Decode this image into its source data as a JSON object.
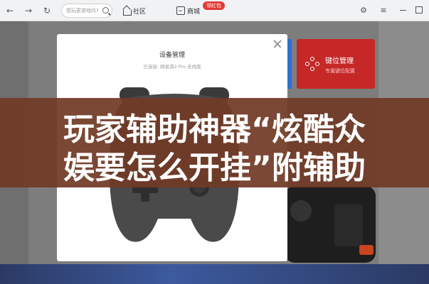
{
  "toolbar": {
    "search_placeholder": "想玩更游戏吗?",
    "tabs": [
      {
        "label": "社区"
      },
      {
        "label": "商城"
      }
    ],
    "badge": "领红包"
  },
  "modal": {
    "title": "设备管理",
    "subtitle": "已连接: 网易游2 Pro 无线版"
  },
  "key_card": {
    "title": "键位管理",
    "subtitle": "专属键位配置"
  },
  "banner": {
    "line1": "玩家辅助神器“炫酷众",
    "line2": "娱要怎么开挂”附辅助"
  },
  "colors": {
    "key_card": "#c62828",
    "banner": "#703a26",
    "badge": "#e53935"
  }
}
